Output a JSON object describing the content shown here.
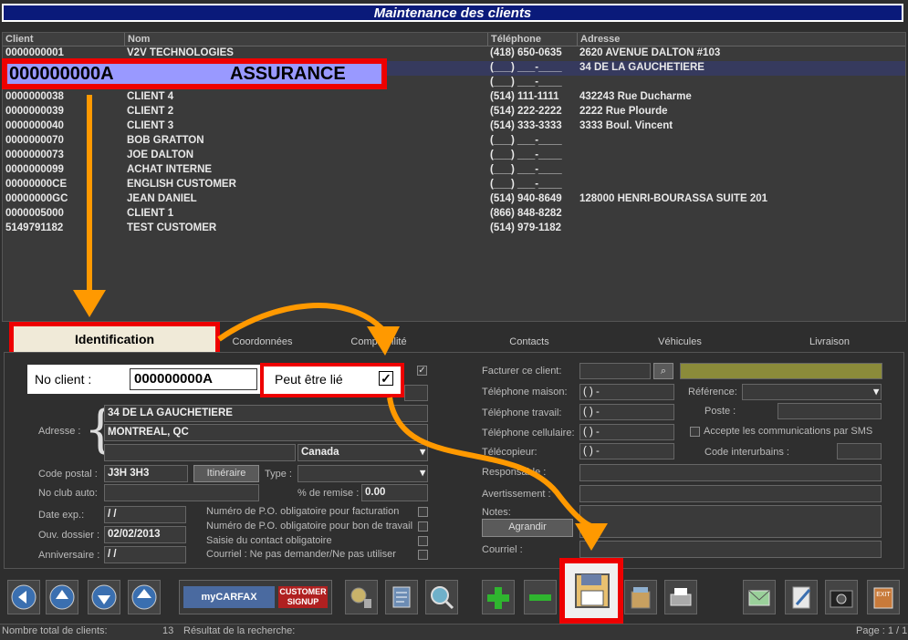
{
  "window": {
    "title": "Maintenance des clients"
  },
  "grid": {
    "headers": {
      "client": "Client",
      "nom": "Nom",
      "telephone": "Téléphone",
      "adresse": "Adresse"
    },
    "rows": [
      {
        "client": "0000000001",
        "nom": "V2V TECHNOLOGIES",
        "tel": "(418) 650-0635",
        "adresse": "2620 AVENUE DALTON #103"
      },
      {
        "client": "",
        "nom": "",
        "tel": "(___) ___-____",
        "adresse": "34 DE LA GAUCHETIERE"
      },
      {
        "client": "",
        "nom": "",
        "tel": "(___) ___-____",
        "adresse": ""
      },
      {
        "client": "0000000038",
        "nom": "CLIENT 4",
        "tel": "(514) 111-1111",
        "adresse": "432243 Rue Ducharme"
      },
      {
        "client": "0000000039",
        "nom": "CLIENT 2",
        "tel": "(514) 222-2222",
        "adresse": "2222 Rue Plourde"
      },
      {
        "client": "0000000040",
        "nom": "CLIENT 3",
        "tel": "(514) 333-3333",
        "adresse": "3333 Boul. Vincent"
      },
      {
        "client": "0000000070",
        "nom": "BOB GRATTON",
        "tel": "(___) ___-____",
        "adresse": ""
      },
      {
        "client": "0000000073",
        "nom": "JOE DALTON",
        "tel": "(___) ___-____",
        "adresse": ""
      },
      {
        "client": "0000000099",
        "nom": "ACHAT INTERNE",
        "tel": "(___) ___-____",
        "adresse": ""
      },
      {
        "client": "00000000CE",
        "nom": "ENGLISH CUSTOMER",
        "tel": "(___) ___-____",
        "adresse": ""
      },
      {
        "client": "00000000GC",
        "nom": "JEAN DANIEL",
        "tel": "(514) 940-8649",
        "adresse": "128000 HENRI-BOURASSA SUITE 201"
      },
      {
        "client": "0000005000",
        "nom": "CLIENT 1",
        "tel": "(866) 848-8282",
        "adresse": ""
      },
      {
        "client": "5149791182",
        "nom": "TEST CUSTOMER",
        "tel": "(514) 979-1182",
        "adresse": ""
      }
    ],
    "highlight": {
      "client": "000000000A",
      "nom": "ASSURANCE"
    }
  },
  "tabs": {
    "identification": "Identification",
    "coordonnees": "Coordonnées",
    "comptabilite": "Comptabilité",
    "contacts": "Contacts",
    "vehicules": "Véhicules",
    "livraison": "Livraison"
  },
  "form": {
    "no_client_label": "No client :",
    "no_client_value": "000000000A",
    "peut_etre_lie": "Peut être lié",
    "adresse_label": "Adresse :",
    "adresse1": "34 DE LA GAUCHETIERE",
    "adresse2": "MONTREAL, QC",
    "pays": "Canada",
    "code_postal_label": "Code postal :",
    "code_postal": "J3H 3H3",
    "itineraire": "Itinéraire",
    "type_label": "Type :",
    "no_club_label": "No club auto:",
    "remise_label": "% de remise :",
    "remise": "0.00",
    "date_exp_label": "Date exp.:",
    "date_exp": "/ /",
    "ouv_dossier_label": "Ouv. dossier :",
    "ouv_dossier": "02/02/2013",
    "anniversaire_label": "Anniversaire :",
    "anniversaire": "/ /",
    "po_facturation": "Numéro de P.O. obligatoire pour facturation",
    "po_bon_travail": "Numéro de P.O. obligatoire pour bon de travail",
    "saisie_contact": "Saisie du contact obligatoire",
    "courriel_ne_pas": "Courriel : Ne pas demander/Ne pas utiliser",
    "facturer_label": "Facturer ce client:",
    "tel_maison": "Téléphone maison:",
    "tel_travail": "Téléphone travail:",
    "tel_cellulaire": "Téléphone cellulaire:",
    "telecopieur": "Télécopieur:",
    "phone_mask": "(   )    -",
    "reference_label": "Référence:",
    "poste_label": "Poste :",
    "sms_label": "Accepte les communications par SMS",
    "code_interurbains": "Code interurbains :",
    "responsable_label": "Responsable :",
    "avertissement_label": "Avertissement :",
    "notes_label": "Notes:",
    "agrandir": "Agrandir",
    "courriel_label": "Courriel :"
  },
  "toolbar": {
    "carfax_brand": "myCARFAX",
    "carfax_signup": "CUSTOMER SIGNUP",
    "exit": "EXIT"
  },
  "status": {
    "total_label": "Nombre total de clients:",
    "total_value": "13",
    "result_label": "Résultat de la recherche:",
    "page": "Page : 1 / 1"
  },
  "colors": {
    "accent_red": "#e00000",
    "arrow_orange": "#ff9900",
    "title_blue": "#0a1a7a"
  }
}
